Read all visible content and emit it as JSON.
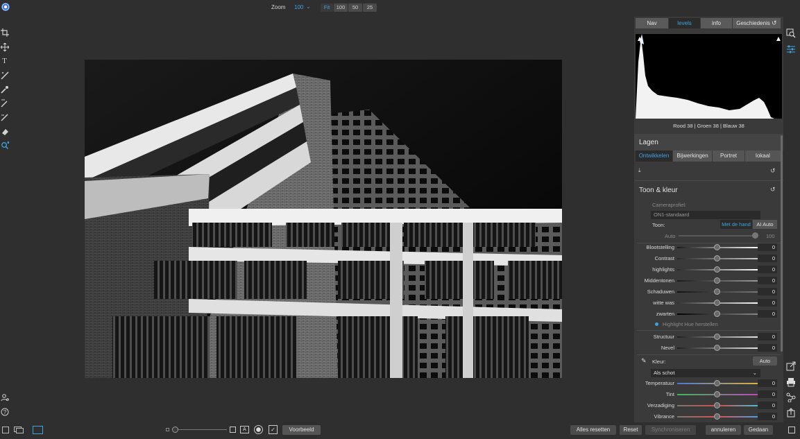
{
  "toolbar": {
    "zoom_label": "Zoom",
    "zoom_value": "100",
    "zoom_presets": [
      "Fit",
      "100",
      "50",
      "25"
    ]
  },
  "panel_tabs": [
    "Nav",
    "levels",
    "info",
    "Geschiedenis"
  ],
  "histogram": {
    "readout": "Rood  38   | Groen  38   | Blauw  38"
  },
  "layers": {
    "title": "Lagen",
    "tabs": [
      "Ontwikkelen",
      "Bijwerkingen",
      "Portret",
      "lokaal"
    ]
  },
  "tone_color": {
    "title": "Toon & kleur",
    "camera_profile_label": "Cameraprofiel:",
    "camera_profile_value": "ON1-standaard",
    "tone_label": "Toon:",
    "tone_manual": "Met de hand",
    "tone_ai": "AI Auto",
    "auto_label": "Auto",
    "auto_value": "100",
    "sliders": [
      {
        "label": "Blootstelling",
        "value": "0"
      },
      {
        "label": "Contrast",
        "value": "0"
      },
      {
        "label": "highlights",
        "value": "0"
      },
      {
        "label": "Middentonen",
        "value": "0"
      },
      {
        "label": "Schaduwen",
        "value": "0"
      },
      {
        "label": "witte was",
        "value": "0"
      },
      {
        "label": "zwarten",
        "value": "0"
      }
    ],
    "highlight_hue": "Highlight Hue herstellen",
    "sliders2": [
      {
        "label": "Structuur",
        "value": "0"
      },
      {
        "label": "Nevel",
        "value": "0"
      }
    ],
    "color_label": "Kleur:",
    "color_auto": "Auto",
    "color_mode": "Als schot",
    "color_sliders": [
      {
        "label": "Temperatuur",
        "value": "0"
      },
      {
        "label": "Tint",
        "value": "0"
      },
      {
        "label": "Verzadiging",
        "value": "0"
      },
      {
        "label": "Vibrance",
        "value": "0"
      }
    ]
  },
  "bottom": {
    "preview": "Voorbeeld",
    "reset_all": "Alles resetten",
    "reset": "Reset",
    "sync": "Synchroniseren",
    "cancel": "annuleren",
    "done": "Gedaan"
  },
  "colors": {
    "accent": "#3fa3e0",
    "panel": "#3a3a3a",
    "background": "#2f2f2f"
  }
}
